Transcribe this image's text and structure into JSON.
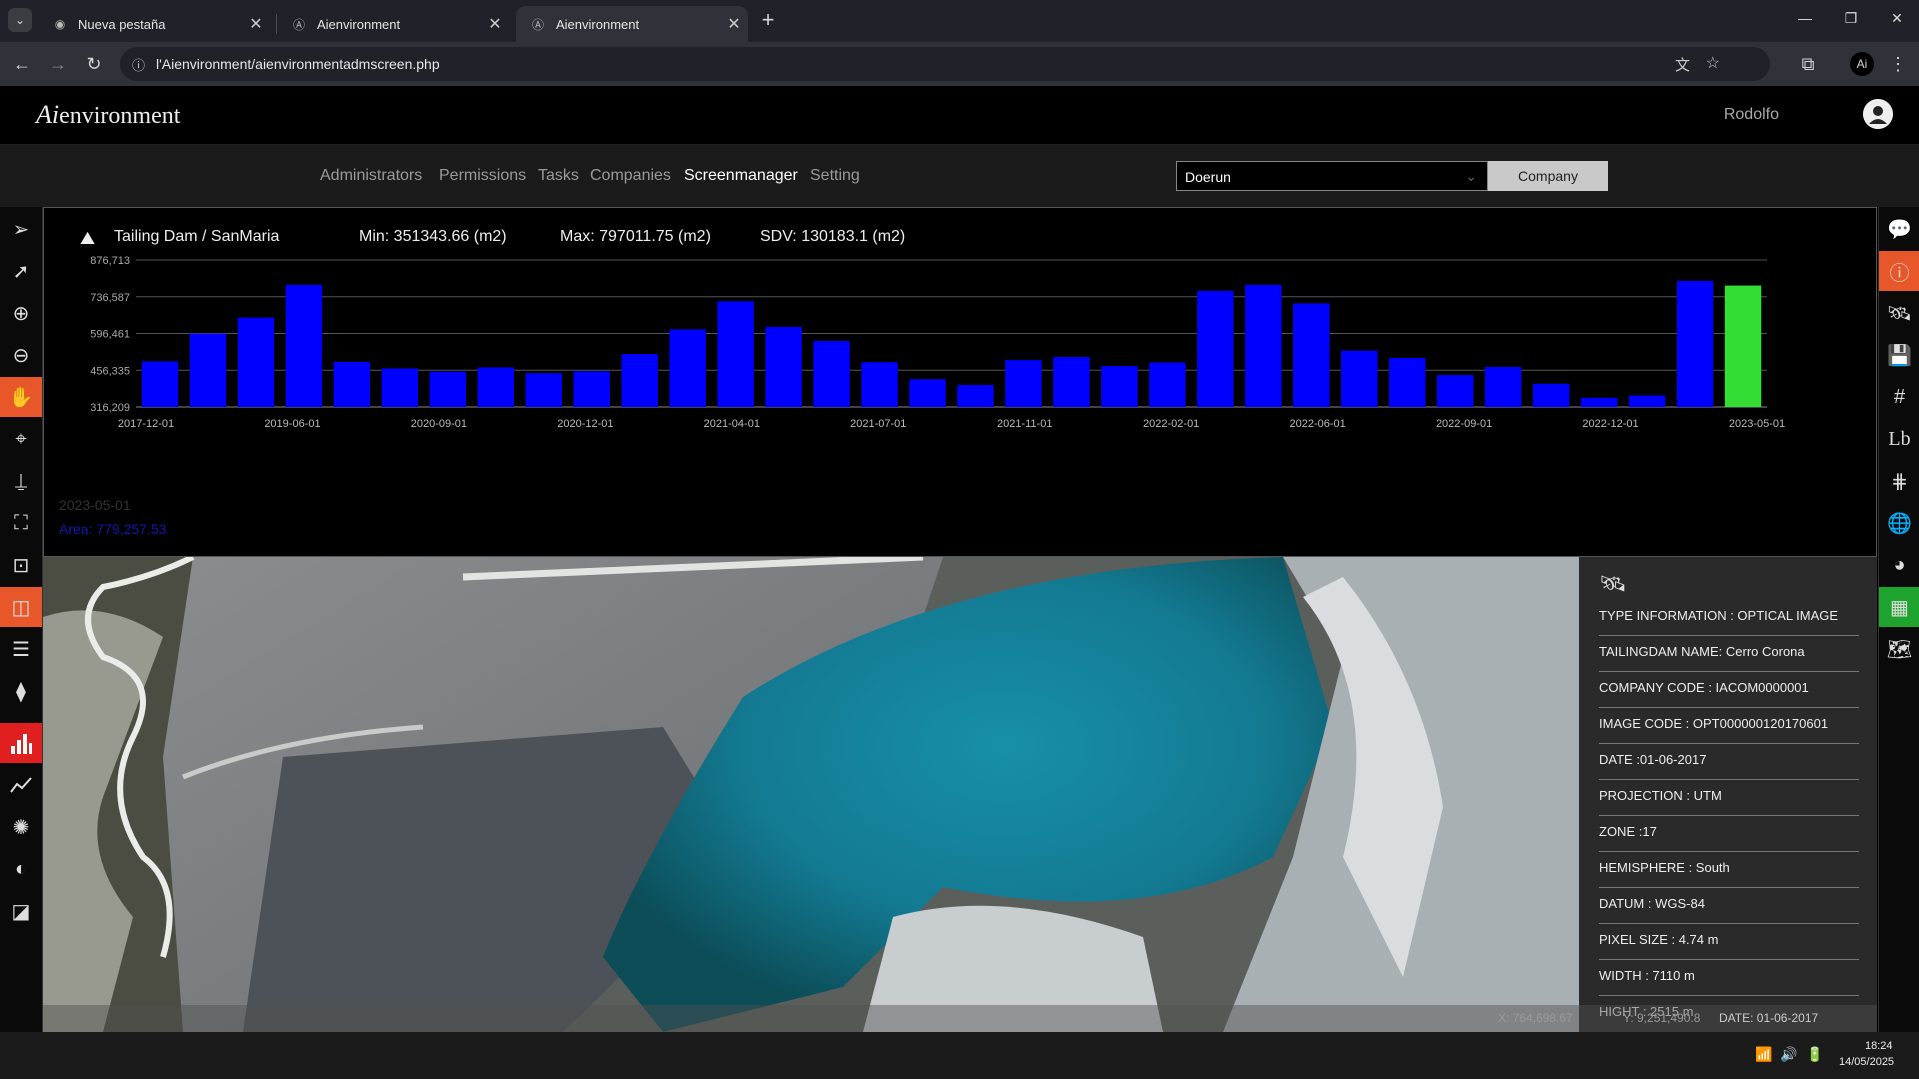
{
  "browser": {
    "tabs": [
      {
        "title": "Nueva pestaña",
        "active": false
      },
      {
        "title": "Aienvironment",
        "active": false
      },
      {
        "title": "Aienvironment",
        "active": true
      }
    ],
    "url": "l'Aienvironment/aienvironmentadmscreen.php"
  },
  "app": {
    "logo_ai": "Ai",
    "logo_rest": "environment",
    "user": "Rodolfo",
    "nav": [
      "Administrators",
      "Permissions",
      "Tasks",
      "Companies",
      "Screenmanager",
      "Setting"
    ],
    "nav_active": "Screenmanager",
    "company_select": "Doerun",
    "company_button": "Company"
  },
  "chart_header": {
    "site": "Tailing Dam / SanMaria",
    "min": "Min: 351343.66 (m2)",
    "max": "Max: 797011.75 (m2)",
    "sdv": "SDV: 130183.1 (m2)"
  },
  "selection": {
    "date": "2023-05-01",
    "area": "Area: 779,257.53"
  },
  "chart_data": {
    "type": "bar",
    "ylim": [
      316209,
      876713
    ],
    "yticks": [
      "876,713",
      "736,587",
      "596,461",
      "456,335",
      "316,209"
    ],
    "xtick_labels": [
      "2017-12-01",
      "2019-06-01",
      "2020-09-01",
      "2020-12-01",
      "2021-04-01",
      "2021-07-01",
      "2021-11-01",
      "2022-02-01",
      "2022-06-01",
      "2022-09-01",
      "2022-12-01",
      "2023-05-01"
    ],
    "values": [
      490000,
      596000,
      657000,
      782000,
      488000,
      463000,
      451000,
      467000,
      445000,
      452000,
      518000,
      612000,
      719000,
      622000,
      568000,
      487000,
      422000,
      400000,
      495000,
      507000,
      472000,
      486000,
      759000,
      782000,
      711000,
      531000,
      503000,
      438000,
      469000,
      405000,
      351343,
      360000,
      797011,
      779257
    ],
    "highlight_index": 33,
    "bar_color": "#0000ff",
    "highlight_color": "#33dd33"
  },
  "info": {
    "rows": [
      "TYPE INFORMATION : OPTICAL IMAGE",
      "TAILINGDAM NAME: Cerro Corona",
      "COMPANY CODE : IACOM0000001",
      "IMAGE CODE : OPT000000120170601",
      "DATE :01-06-2017",
      "PROJECTION : UTM",
      "ZONE :17",
      "HEMISPHERE : South",
      "DATUM : WGS-84",
      "PIXEL SIZE : 4.74 m",
      "WIDTH : 7110 m",
      "HIGHT : 2515 m"
    ]
  },
  "status": {
    "coords": "X: 764,698.67",
    "coords2": "Y: 9,251,490.8",
    "date": "DATE: 01-06-2017"
  },
  "taskbar": {
    "time": "18:24",
    "date": "14/05/2025"
  }
}
